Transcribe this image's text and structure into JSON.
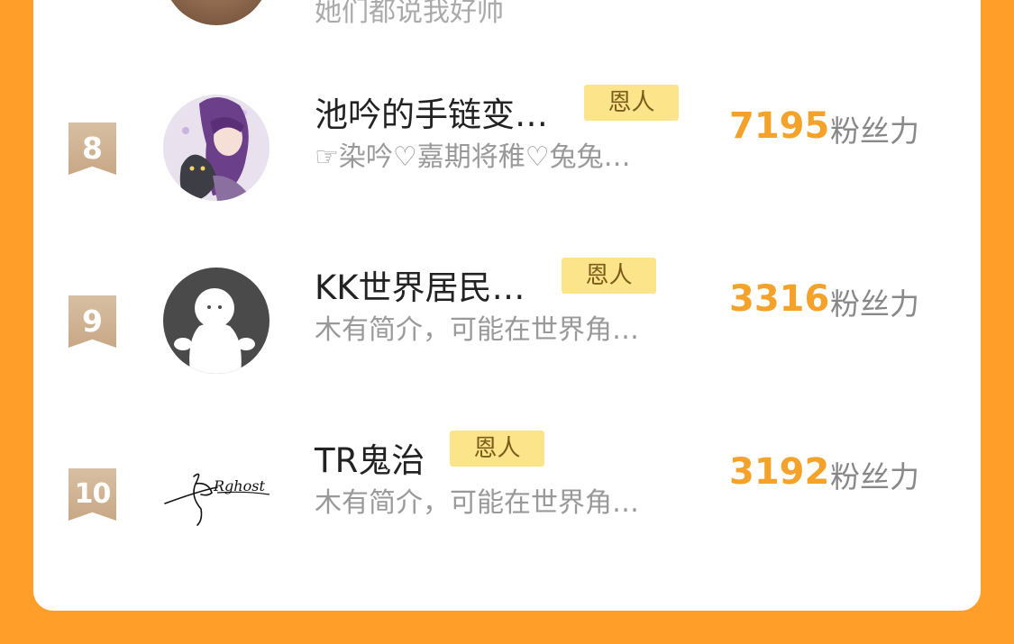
{
  "partial_row": {
    "bio": "她们都说我好帅"
  },
  "rows": [
    {
      "rank": "8",
      "name": "池吟的手链变…",
      "badge": "恩人",
      "bio": "☞染吟♡嘉期将稚♡兔兔…",
      "score": "7195",
      "unit": "粉丝力"
    },
    {
      "rank": "9",
      "name": "KK世界居民…",
      "badge": "恩人",
      "bio": "木有简介，可能在世界角…",
      "score": "3316",
      "unit": "粉丝力"
    },
    {
      "rank": "10",
      "name": "TR鬼治",
      "badge": "恩人",
      "bio": "木有简介，可能在世界角…",
      "score": "3192",
      "unit": "粉丝力",
      "avatar_text": "Rghost"
    }
  ]
}
